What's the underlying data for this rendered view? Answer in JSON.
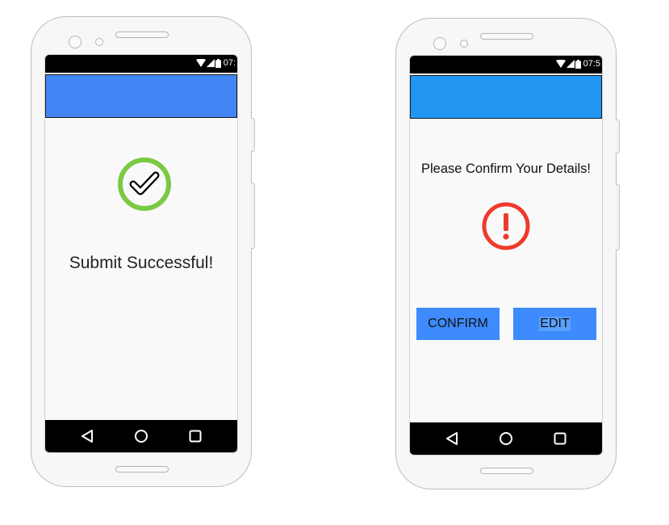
{
  "left_phone": {
    "status_time": "07:",
    "message": "Submit Successful!",
    "icons": {
      "status": [
        "wifi-icon",
        "signal-icon",
        "battery-icon"
      ],
      "main": "check-circle-icon",
      "nav": [
        "back-icon",
        "home-icon",
        "recents-icon"
      ]
    },
    "colors": {
      "app_bar": "#4285f4",
      "check_ring": "#7ac943"
    }
  },
  "right_phone": {
    "status_time": "07:5",
    "title": "Please Confirm Your Details!",
    "confirm_label": "CONFIRM",
    "edit_label": "EDIT",
    "icons": {
      "status": [
        "wifi-icon",
        "signal-icon",
        "battery-icon"
      ],
      "main": "exclamation-circle-icon",
      "nav": [
        "back-icon",
        "home-icon",
        "recents-icon"
      ]
    },
    "colors": {
      "app_bar": "#2196f3",
      "alert": "#ee3a2c",
      "button": "#3d8bfd"
    }
  }
}
